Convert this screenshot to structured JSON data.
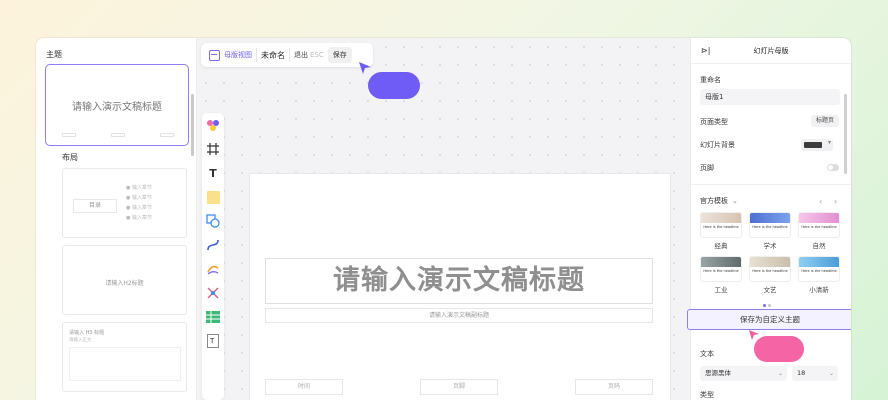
{
  "left_panel": {
    "theme_label": "主题",
    "theme_title": "请输入演示文稿标题",
    "layout_label": "布局",
    "layout_cards": [
      {
        "title": "目录",
        "items": [
          "● 输入章节",
          "● 输入章节",
          "● 输入章节",
          "● 输入章节"
        ]
      },
      {
        "title": "请输入H2标题"
      },
      {
        "title": "请输入 H3 标题",
        "body": "请输入正文"
      }
    ]
  },
  "toolbar": {
    "master_view": "母版视图",
    "doc_name": "未命名",
    "exit": "退出",
    "esc": "ESC",
    "save": "保存"
  },
  "tools": [
    "palette-icon",
    "frame-icon",
    "text-icon",
    "sticky-note-icon",
    "shape-icon",
    "connector-icon",
    "pen-icon",
    "mindmap-icon",
    "table-icon",
    "text-box-icon"
  ],
  "slide": {
    "title": "请输入演示文稿标题",
    "subtitle": "请输入演示文稿副标题",
    "footer": [
      "时间",
      "页脚",
      "页码"
    ]
  },
  "right_panel": {
    "panel_title": "幻灯片母版",
    "collapse_glyph": "⊳|",
    "rename_label": "重命名",
    "rename_value": "母版1",
    "page_type_label": "页面类型",
    "page_type_value": "标题页",
    "background_label": "幻灯片背景",
    "footer_label": "页脚",
    "official_templates_label": "官方模板",
    "templates": [
      {
        "name": "经典",
        "caption": "Here is the headline",
        "color": "#e3d2c4"
      },
      {
        "name": "学术",
        "caption": "Here is the headline",
        "color": "#5b84d8"
      },
      {
        "name": "自然",
        "caption": "Here is the headline",
        "color": "#f3b7e4"
      },
      {
        "name": "工业",
        "caption": "Here is the headline",
        "color": "#7c8a8a"
      },
      {
        "name": "文艺",
        "caption": "Here is the headline",
        "color": "#d9d2c2"
      },
      {
        "name": "小清新",
        "caption": "Here is the headline",
        "color": "#6fb6e6"
      }
    ],
    "save_theme": "保存为自定义主题",
    "text_label": "文本",
    "font_family": "思源黑体",
    "font_size": "18",
    "type_label": "类型"
  },
  "colors": {
    "accent": "#6f5cf6",
    "pink": "#f45da0"
  }
}
